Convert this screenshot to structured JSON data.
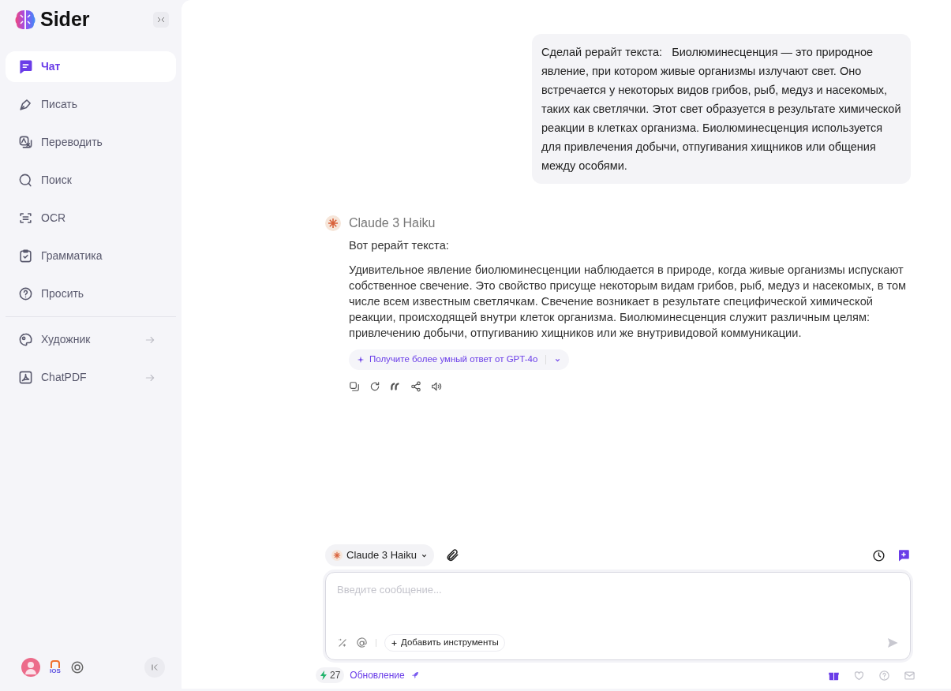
{
  "sidebar": {
    "brand": "Sider",
    "nav_groups": [
      [
        {
          "label": "Чат",
          "selected": true,
          "arrow": false
        },
        {
          "label": "Писать",
          "selected": false,
          "arrow": false
        },
        {
          "label": "Переводить",
          "selected": false,
          "arrow": false
        },
        {
          "label": "Поиск",
          "selected": false,
          "arrow": false
        },
        {
          "label": "OCR",
          "selected": false,
          "arrow": false
        },
        {
          "label": "Грамматика",
          "selected": false,
          "arrow": false
        },
        {
          "label": "Просить",
          "selected": false,
          "arrow": false
        }
      ],
      [
        {
          "label": "Художник",
          "selected": false,
          "arrow": true
        },
        {
          "label": "ChatPDF",
          "selected": false,
          "arrow": true
        }
      ]
    ],
    "ios_label": "IOS"
  },
  "chat": {
    "user_message": "Сделай рерайт текста:   Биолюминесценция — это природное явление, при котором живые организмы излучают свет. Оно встречается у некоторых видов грибов, рыб, медуз и насекомых, таких как светлячки. Этот свет образуется в результате химической реакции в клетках организма. Биолюминесценция используется для привлечения добычи, отпугивания хищников или общения между особями.",
    "reply": {
      "model": "Claude 3 Haiku",
      "paragraphs": [
        "Вот рерайт текста:",
        "Удивительное явление биолюминесценции наблюдается в природе, когда живые организмы испускают собственное свечение. Это свойство присуще некоторым видам грибов, рыб, медуз и насекомых, в том числе всем известным светлячкам. Свечение возникает в результате специфической химической реакции, происходящей внутри клеток организма. Биолюминесценция служит различным целям: привлечению добычи, отпугиванию хищников или же внутривидовой коммуникации."
      ],
      "upgrade_button": "Получите более умный ответ от GPT-4o"
    }
  },
  "composer": {
    "model_selector": "Claude 3 Haiku",
    "placeholder": "Введите сообщение...",
    "tools_button": "Добавить инструменты"
  },
  "status_bar": {
    "credits": "27",
    "update_link": "Обновление"
  }
}
